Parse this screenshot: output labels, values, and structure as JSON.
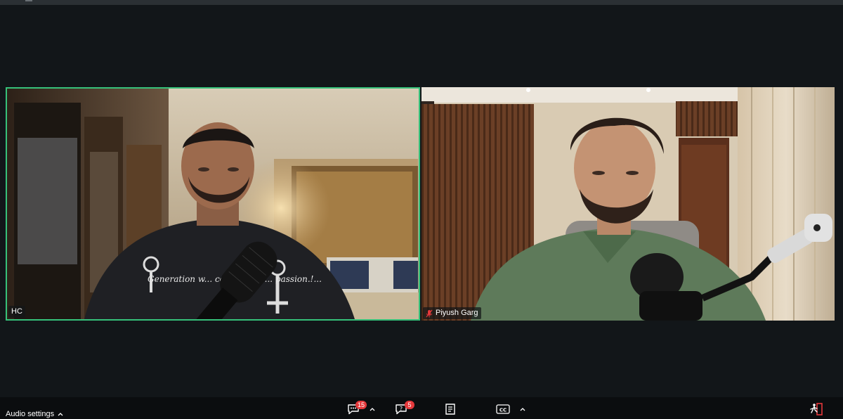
{
  "participants": [
    {
      "name": "HC",
      "active_speaker": true,
      "muted": false
    },
    {
      "name": "Piyush Garg",
      "active_speaker": false,
      "muted": true
    }
  ],
  "shirt_print_text": "Generation w... convention ... passion.!... ",
  "toolbar": {
    "audio_settings_label": "Audio settings",
    "chat_badge": "15",
    "qa_badge": "5",
    "cc_label": "CC"
  },
  "icons": {
    "chat": "chat-icon",
    "qa": "question-icon",
    "notes": "notes-icon",
    "captions": "closed-captions-icon",
    "leave": "leave-icon",
    "muted": "mic-muted-icon"
  },
  "colors": {
    "active_border": "#36c17a",
    "badge": "#e5383b",
    "leave": "#e5383b",
    "background": "#121619"
  }
}
